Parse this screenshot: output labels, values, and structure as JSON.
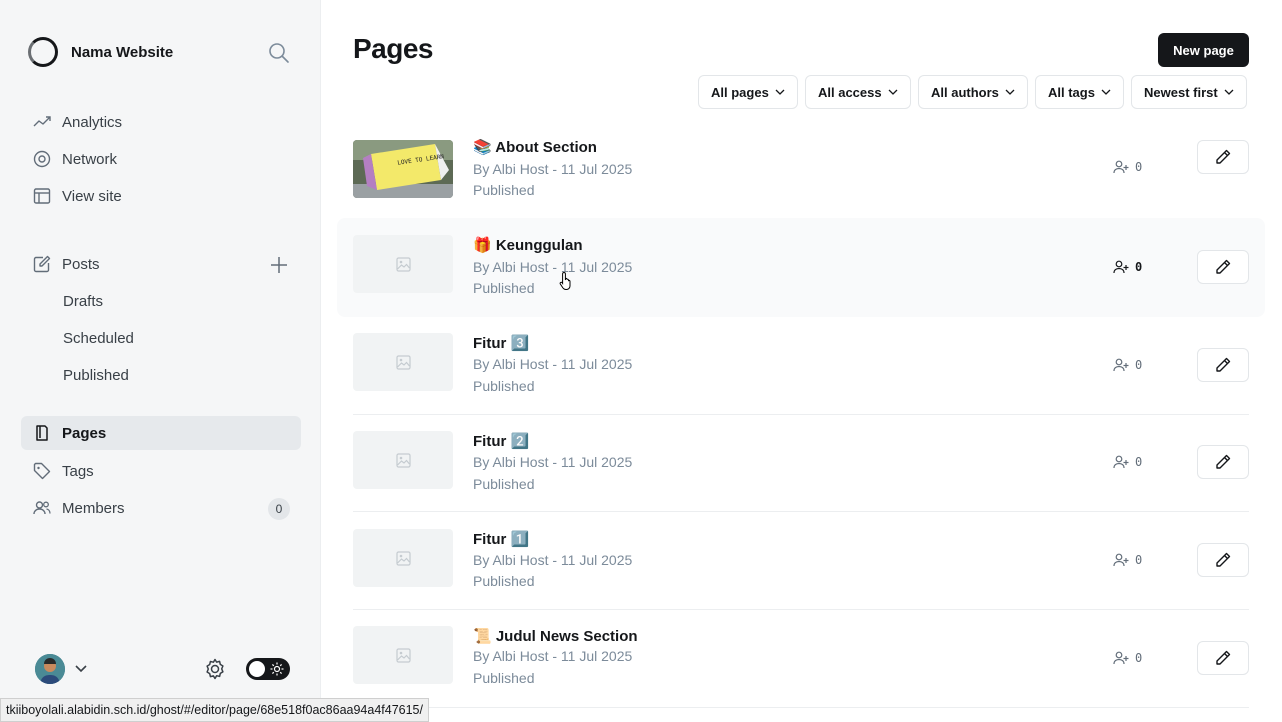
{
  "brand": {
    "name": "Nama Website"
  },
  "sidebar": {
    "items": [
      {
        "label": "Analytics"
      },
      {
        "label": "Network"
      },
      {
        "label": "View site"
      },
      {
        "label": "Posts"
      },
      {
        "label": "Drafts"
      },
      {
        "label": "Scheduled"
      },
      {
        "label": "Published"
      },
      {
        "label": "Pages"
      },
      {
        "label": "Tags"
      },
      {
        "label": "Members",
        "badge": "0"
      }
    ]
  },
  "header": {
    "title": "Pages",
    "new_button": "New page"
  },
  "filters": [
    {
      "label": "All pages"
    },
    {
      "label": "All access"
    },
    {
      "label": "All authors"
    },
    {
      "label": "All tags"
    },
    {
      "label": "Newest first"
    }
  ],
  "rows": [
    {
      "title": "📚 About Section",
      "meta": "By Albi Host - 11 Jul 2025",
      "status": "Published",
      "signups": "0"
    },
    {
      "title": "🎁 Keunggulan",
      "meta": "By Albi Host - 11 Jul 2025",
      "status": "Published",
      "signups": "0"
    },
    {
      "title": "Fitur 3️⃣",
      "meta": "By Albi Host - 11 Jul 2025",
      "status": "Published",
      "signups": "0"
    },
    {
      "title": "Fitur 2️⃣",
      "meta": "By Albi Host - 11 Jul 2025",
      "status": "Published",
      "signups": "0"
    },
    {
      "title": "Fitur 1️⃣",
      "meta": "By Albi Host - 11 Jul 2025",
      "status": "Published",
      "signups": "0"
    },
    {
      "title": "📜 Judul News Section",
      "meta": "By Albi Host - 11 Jul 2025",
      "status": "Published",
      "signups": "0"
    }
  ],
  "thumbnail_text": "LOVE TO LEARN",
  "status_bar": {
    "url": "tkiiboyolali.alabidin.sch.id/ghost/#/editor/page/68e518f0ac86aa94a4f47615/"
  },
  "colors": {
    "accent": "#15171a",
    "muted_text": "#7c8b9a",
    "sidebar_bg": "#f5f6f7",
    "active_bg": "#e6e9ec"
  }
}
